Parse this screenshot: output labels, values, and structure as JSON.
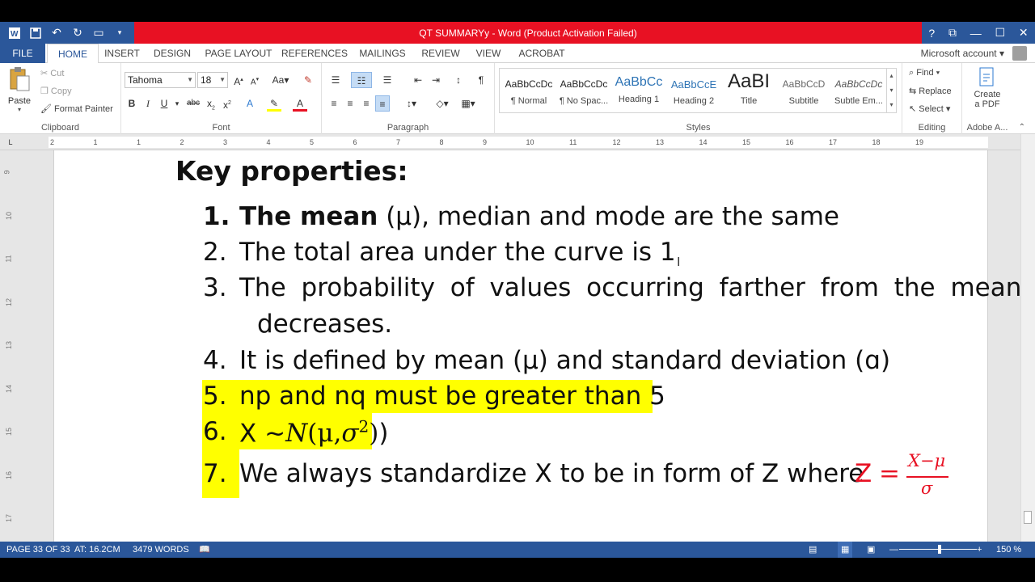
{
  "window": {
    "title": "QT SUMMARYy -  Word (Product Activation Failed)",
    "controls": [
      "?",
      "⧉",
      "—",
      "☐",
      "✕"
    ]
  },
  "tabs": [
    "FILE",
    "HOME",
    "INSERT",
    "DESIGN",
    "PAGE LAYOUT",
    "REFERENCES",
    "MAILINGS",
    "REVIEW",
    "VIEW",
    "ACROBAT"
  ],
  "account": "Microsoft account",
  "clipboard": {
    "paste": "Paste",
    "cut": "Cut",
    "copy": "Copy",
    "format_painter": "Format Painter",
    "label": "Clipboard"
  },
  "font": {
    "name": "Tahoma",
    "size": "18",
    "label": "Font"
  },
  "paragraph": {
    "label": "Paragraph"
  },
  "styles": {
    "label": "Styles",
    "items": [
      {
        "preview": "AaBbCcDc",
        "name": "¶ Normal"
      },
      {
        "preview": "AaBbCcDc",
        "name": "¶ No Spac..."
      },
      {
        "preview": "AaBbCc",
        "name": "Heading 1"
      },
      {
        "preview": "AaBbCcE",
        "name": "Heading 2"
      },
      {
        "preview": "AaBI",
        "name": "Title"
      },
      {
        "preview": "AaBbCcD",
        "name": "Subtitle"
      },
      {
        "preview": "AaBbCcDc",
        "name": "Subtle Em..."
      }
    ]
  },
  "editing": {
    "find": "Find",
    "replace": "Replace",
    "select": "Select",
    "label": "Editing"
  },
  "adobe": {
    "create_line1": "Create",
    "create_line2": "a PDF",
    "label": "Adobe A..."
  },
  "ruler_marks": [
    "2",
    "1",
    "1",
    "2",
    "3",
    "4",
    "5",
    "6",
    "7",
    "8",
    "9",
    "10",
    "11",
    "12",
    "13",
    "14",
    "15",
    "16",
    "17",
    "18",
    "19"
  ],
  "vruler_marks": [
    "9",
    "10",
    "11",
    "12",
    "13",
    "14",
    "15",
    "16",
    "17"
  ],
  "document": {
    "heading": "Key properties:",
    "items": [
      {
        "num": "1.",
        "bold": "The mean",
        "text": " (μ), median and mode are the same"
      },
      {
        "num": "2.",
        "text": "The total area under the curve is 1"
      },
      {
        "num": "3.",
        "text": "The probability of values occurring farther from the mean",
        "cont": "decreases."
      },
      {
        "num": "4.",
        "text": "It is defined by mean (μ) and standard deviation (ɑ)"
      },
      {
        "num": "5.",
        "text": "np and nq must be greater than 5"
      },
      {
        "num": "6.",
        "text": "X ~"
      },
      {
        "num": "7.",
        "text": "We always standardize X to be in form of Z where"
      }
    ],
    "formula6": {
      "n": "N",
      "open": "(",
      "mu": "μ",
      "comma": ",",
      "sigma": "σ",
      "exp": "2",
      "close": ")",
      "trail": ")"
    },
    "formula7": {
      "z": "Z",
      "eq": "=",
      "numer": "X−μ",
      "denom": "σ"
    }
  },
  "status": {
    "page": "PAGE 33 OF 33",
    "at": "AT: 16.2CM",
    "words": "3479 WORDS",
    "zoom": "150 %"
  }
}
